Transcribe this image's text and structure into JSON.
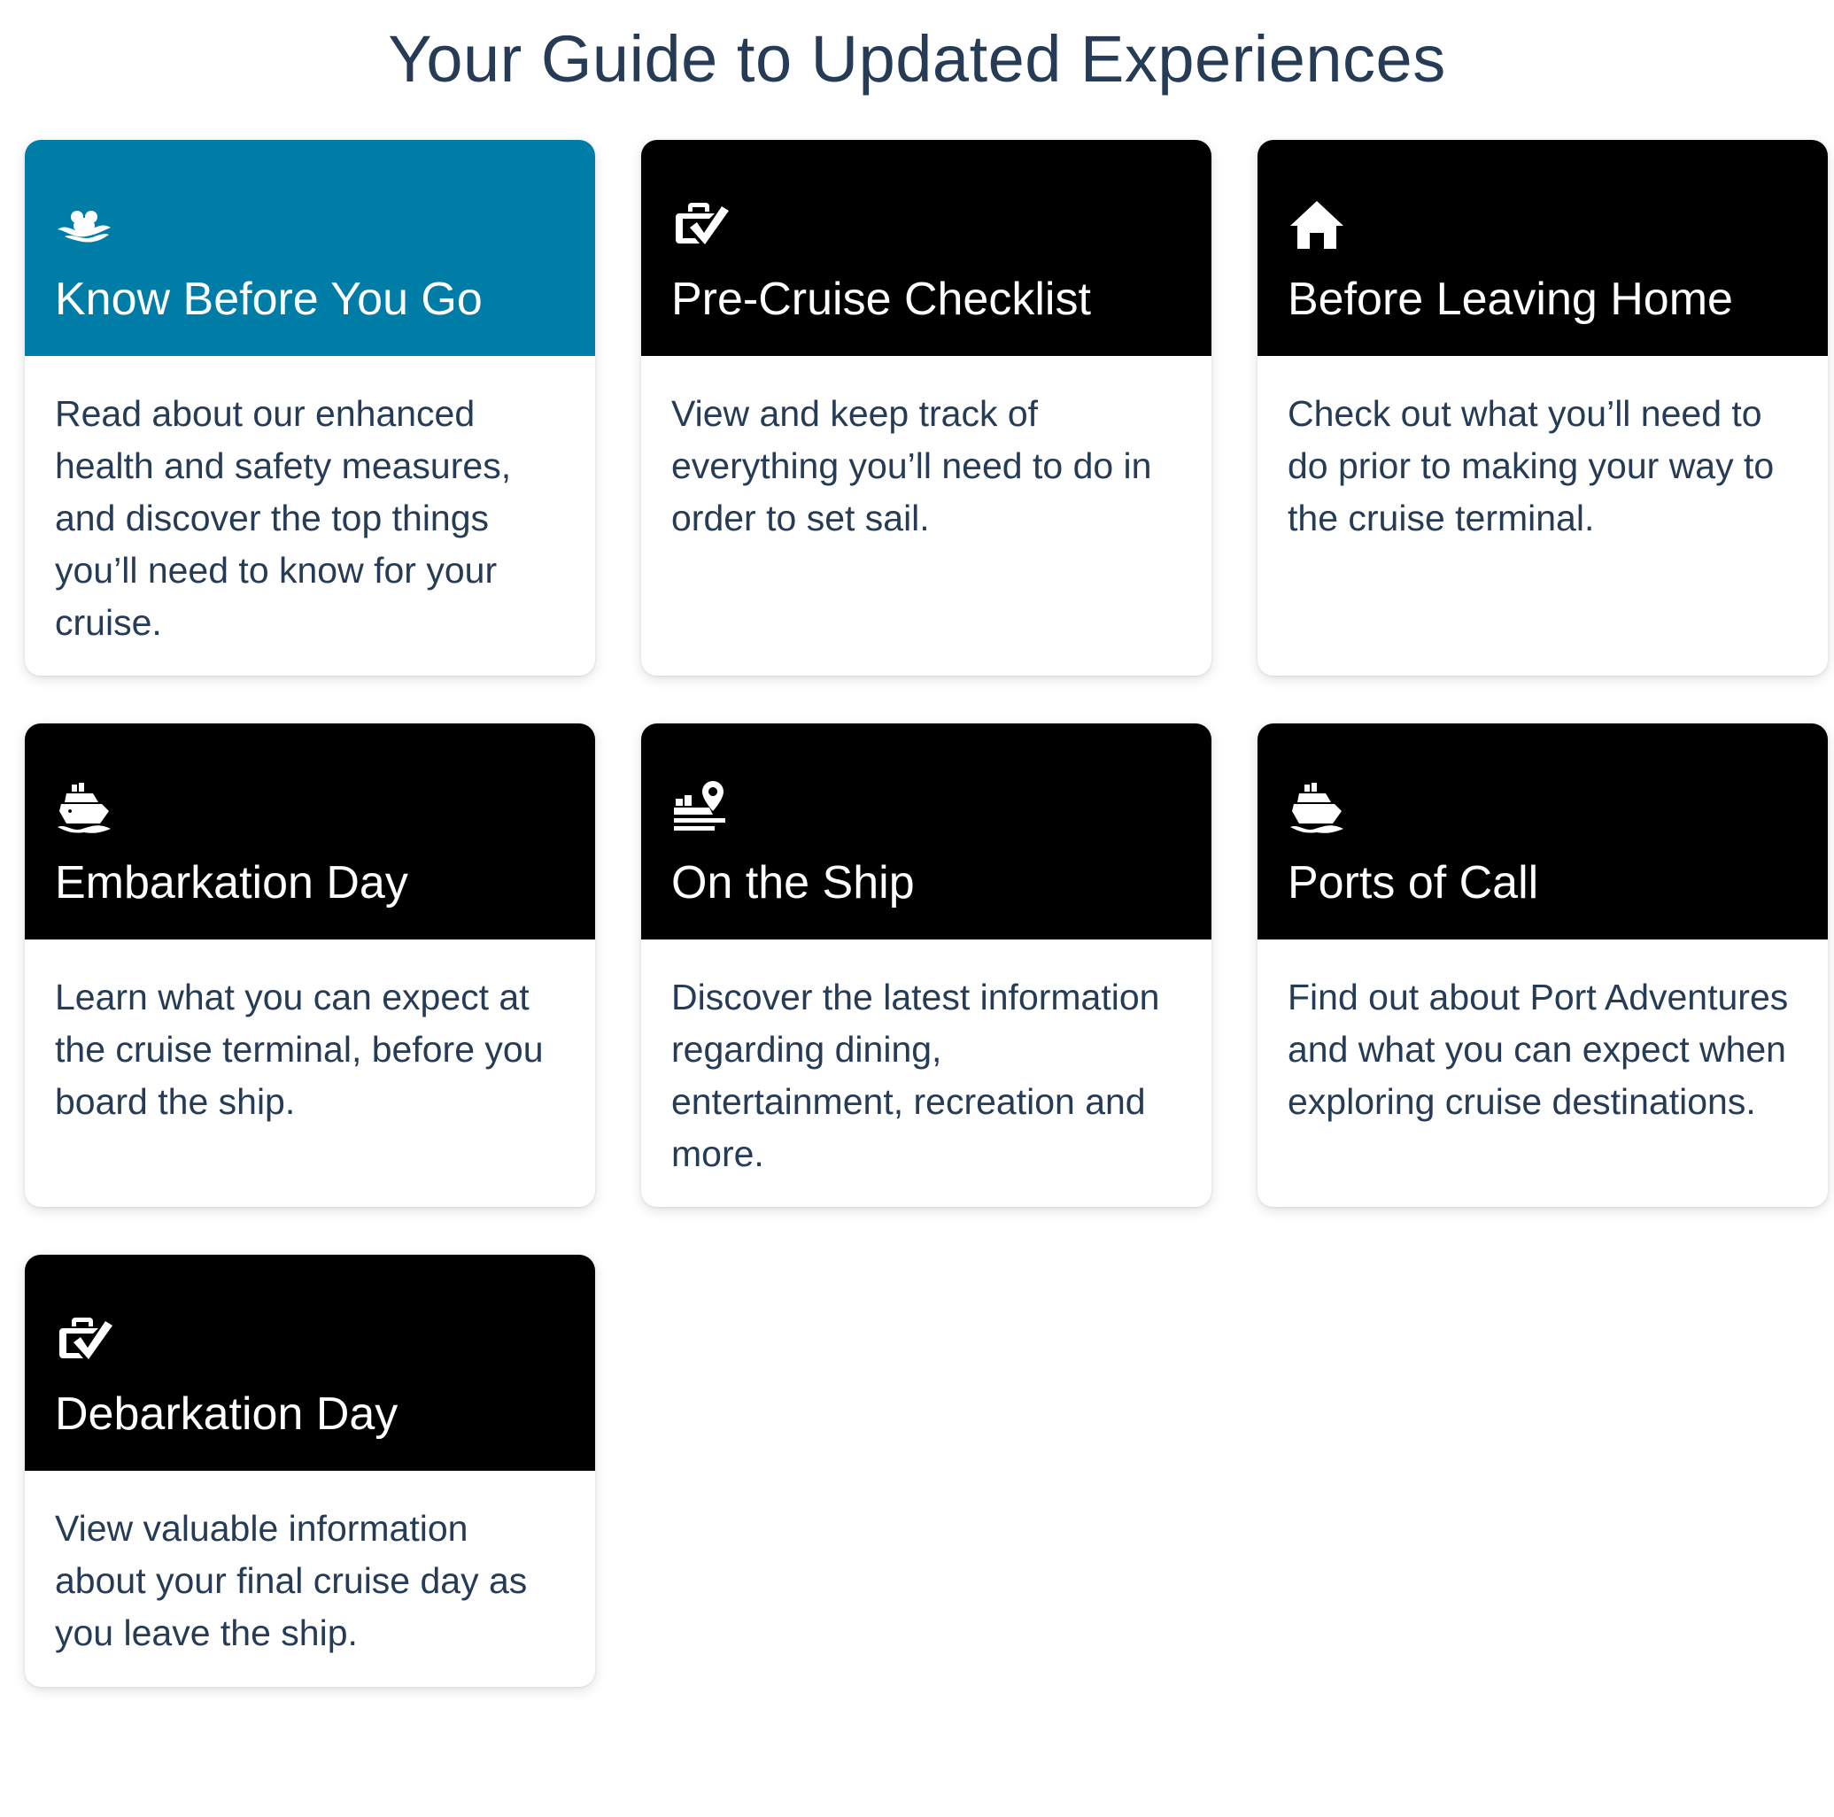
{
  "page": {
    "title": "Your Guide to Updated Experiences"
  },
  "colors": {
    "title": "#253b56",
    "accent_header": "#007da7",
    "dark_header": "#000000",
    "body_text": "#253b56"
  },
  "cards": [
    {
      "icon": "mickey-ship-logo-icon",
      "title": "Know Before You Go",
      "description": "Read about our enhanced health and safety measures, and discover the top things you’ll need to know for your cruise."
    },
    {
      "icon": "luggage-check-icon",
      "title": "Pre-Cruise Checklist",
      "description": "View and keep track of everything you’ll need to do in order to set sail."
    },
    {
      "icon": "home-icon",
      "title": "Before Leaving Home",
      "description": "Check out what you’ll need to do prior to making your way to the cruise terminal."
    },
    {
      "icon": "cruise-ship-icon",
      "title": "Embarkation Day",
      "description": "Learn what you can expect at the cruise terminal, before you board the ship."
    },
    {
      "icon": "ship-location-pin-icon",
      "title": "On the Ship",
      "description": "Discover the latest information regarding dining, entertainment, recreation and more."
    },
    {
      "icon": "cruise-ship-icon",
      "title": "Ports of Call",
      "description": "Find out about Port Adventures and what you can expect when exploring cruise destinations."
    },
    {
      "icon": "luggage-check-icon",
      "title": "Debarkation Day",
      "description": "View valuable information about your final cruise day as you leave the ship."
    }
  ]
}
